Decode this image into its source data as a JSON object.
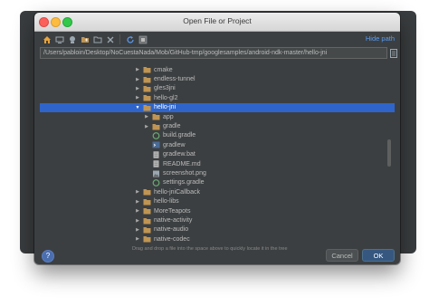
{
  "window": {
    "title": "Open File or Project"
  },
  "toolbar": {
    "icons": [
      "home-icon",
      "desktop-icon",
      "project-icon",
      "new-folder-icon",
      "folder-icon",
      "delete-icon",
      "refresh-icon",
      "show-hidden-icon"
    ],
    "hide_path_label": "Hide path"
  },
  "path": {
    "value": "/Users/pabloin/Desktop/NoCuestaNada/Mob/GitHub-tmp/googlesamples/android-ndk-master/hello-jni"
  },
  "tree": {
    "items": [
      {
        "label": "cmake",
        "type": "folder",
        "level": 0,
        "expanded": false,
        "selected": false
      },
      {
        "label": "endless-tunnel",
        "type": "folder",
        "level": 0,
        "expanded": false,
        "selected": false
      },
      {
        "label": "gles3jni",
        "type": "folder",
        "level": 0,
        "expanded": false,
        "selected": false
      },
      {
        "label": "hello-gl2",
        "type": "folder",
        "level": 0,
        "expanded": false,
        "selected": false
      },
      {
        "label": "hello-jni",
        "type": "folder",
        "level": 0,
        "expanded": true,
        "selected": true
      },
      {
        "label": "app",
        "type": "folder",
        "level": 1,
        "expanded": false,
        "selected": false
      },
      {
        "label": "gradle",
        "type": "folder",
        "level": 1,
        "expanded": false,
        "selected": false
      },
      {
        "label": "build.gradle",
        "type": "gradle",
        "level": 1,
        "selected": false
      },
      {
        "label": "gradlew",
        "type": "script",
        "level": 1,
        "selected": false
      },
      {
        "label": "gradlew.bat",
        "type": "text",
        "level": 1,
        "selected": false
      },
      {
        "label": "README.md",
        "type": "text",
        "level": 1,
        "selected": false
      },
      {
        "label": "screenshot.png",
        "type": "image",
        "level": 1,
        "selected": false
      },
      {
        "label": "settings.gradle",
        "type": "gradle",
        "level": 1,
        "selected": false
      },
      {
        "label": "hello-jniCallback",
        "type": "folder",
        "level": 0,
        "expanded": false,
        "selected": false
      },
      {
        "label": "hello-libs",
        "type": "folder",
        "level": 0,
        "expanded": false,
        "selected": false
      },
      {
        "label": "MoreTeapots",
        "type": "folder",
        "level": 0,
        "expanded": false,
        "selected": false
      },
      {
        "label": "native-activity",
        "type": "folder",
        "level": 0,
        "expanded": false,
        "selected": false
      },
      {
        "label": "native-audio",
        "type": "folder",
        "level": 0,
        "expanded": false,
        "selected": false
      },
      {
        "label": "native-codec",
        "type": "folder",
        "level": 0,
        "expanded": false,
        "selected": false
      }
    ]
  },
  "hint": "Drag and drop a file into the space above to quickly locate it in the tree",
  "buttons": {
    "help": "?",
    "cancel": "Cancel",
    "ok": "OK"
  },
  "colors": {
    "selection": "#2f65ca",
    "link": "#589df6",
    "folder": "#c09553",
    "gradle": "#6aab73"
  }
}
